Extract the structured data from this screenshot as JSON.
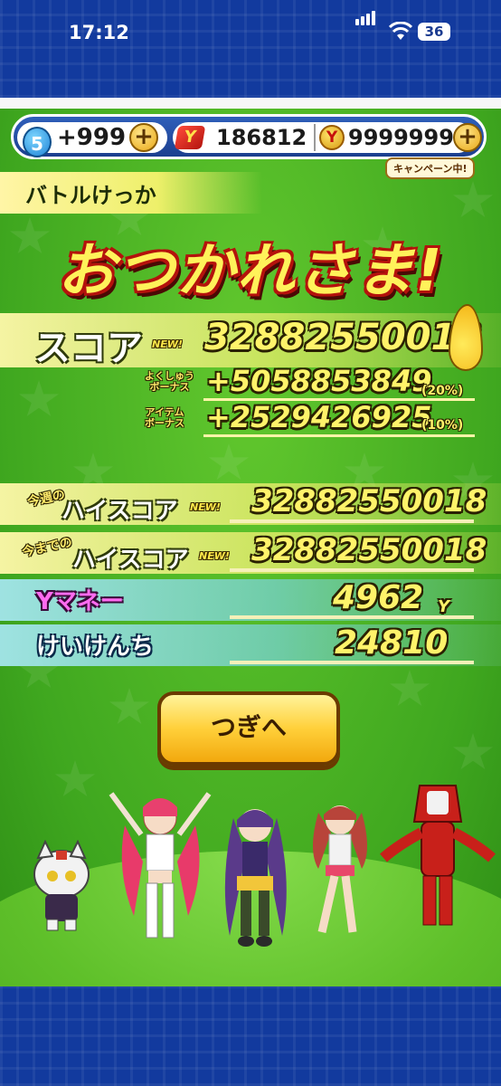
{
  "status_bar": {
    "time": "17:12",
    "battery_level": "36"
  },
  "currency_bar": {
    "stamina_level": "5",
    "stamina_value": "+999",
    "tickets_value": "186812",
    "money_value": "9999999",
    "campaign_label": "キャンペーン中!"
  },
  "result": {
    "header": "バトルけっか",
    "headline": "おつかれさま!",
    "score": {
      "label": "スコア",
      "new_tag": "NEW!",
      "value": "32882550018"
    },
    "bonuses": [
      {
        "label_line1": "よくしゅう",
        "label_line2": "ボーナス",
        "value": "+5058853849",
        "percent": "(20%)"
      },
      {
        "label_line1": "アイテム",
        "label_line2": "ボーナス",
        "value": "+2529426925",
        "percent": "(10%)"
      }
    ],
    "weekly_high": {
      "label_small": "今週の",
      "label_big": "ハイスコア",
      "new_tag": "NEW!",
      "value": "32882550018"
    },
    "alltime_high": {
      "label_small": "今までの",
      "label_big": "ハイスコア",
      "new_tag": "NEW!",
      "value": "32882550018"
    },
    "money": {
      "label": "Yマネー",
      "value": "4962",
      "unit": "Y"
    },
    "exp": {
      "label": "けいけんち",
      "value": "24810"
    }
  },
  "next_button": {
    "label": "つぎへ"
  },
  "colors": {
    "frame_blue": "#123a9e",
    "game_green": "#3fa71f",
    "score_yellow": "#fff36a",
    "button_gold": "#ffd03a"
  }
}
